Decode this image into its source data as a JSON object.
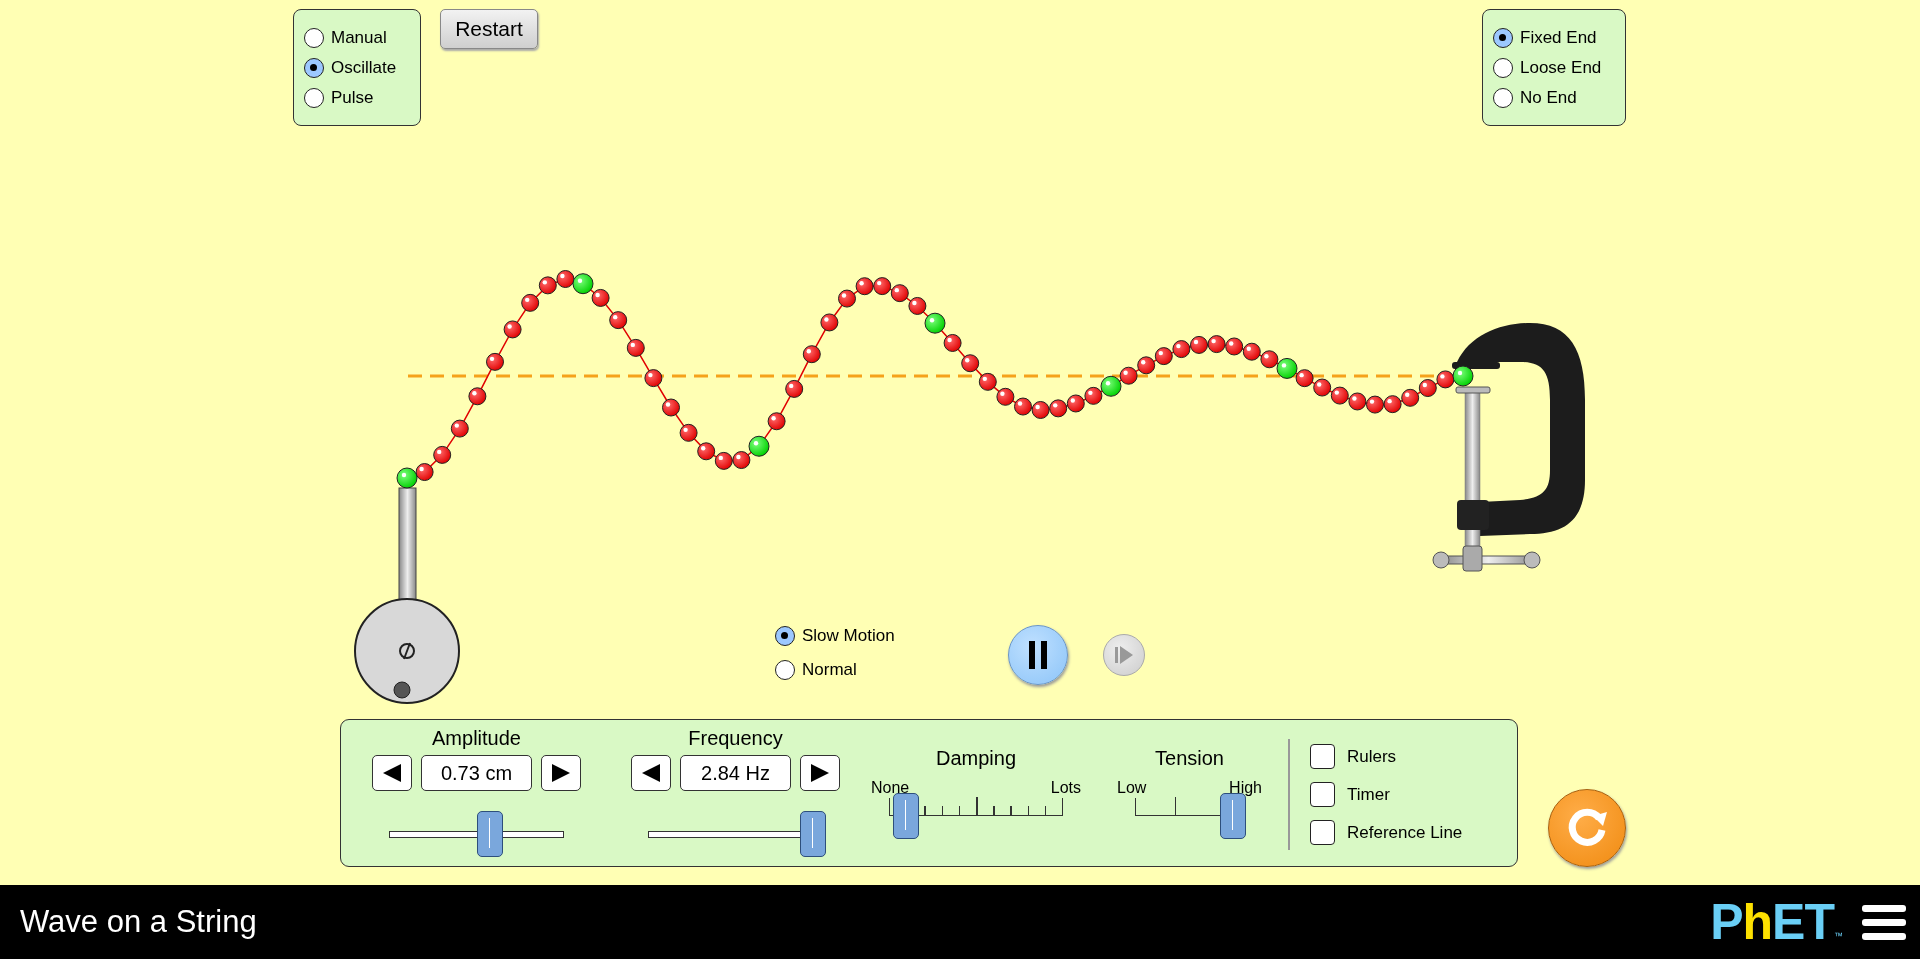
{
  "source_mode": [
    {
      "label": "Manual",
      "selected": false
    },
    {
      "label": "Oscillate",
      "selected": true
    },
    {
      "label": "Pulse",
      "selected": false
    }
  ],
  "restart_button": {
    "label": "Restart"
  },
  "end_mode": [
    {
      "label": "Fixed End",
      "selected": true
    },
    {
      "label": "Loose End",
      "selected": false
    },
    {
      "label": "No End",
      "selected": false
    }
  ],
  "speed": [
    {
      "label": "Slow Motion",
      "selected": true
    },
    {
      "label": "Normal",
      "selected": false
    }
  ],
  "playback": {
    "playing": true,
    "step_disabled": true
  },
  "controls": {
    "amplitude": {
      "label": "Amplitude",
      "value": "0.73 cm",
      "level": 0.58
    },
    "frequency": {
      "label": "Frequency",
      "value": "2.84 Hz",
      "level": 0.94
    },
    "damping": {
      "label": "Damping",
      "min_label": "None",
      "max_label": "Lots",
      "level": 0.1
    },
    "tension": {
      "label": "Tension",
      "min_label": "Low",
      "max_label": "High",
      "level": 0.9
    }
  },
  "options": [
    {
      "label": "Rulers",
      "checked": false
    },
    {
      "label": "Timer",
      "checked": false
    },
    {
      "label": "Reference Line",
      "checked": false
    }
  ],
  "footer": {
    "title": "Wave on a String",
    "logo": "PhET",
    "trademark": "™"
  }
}
